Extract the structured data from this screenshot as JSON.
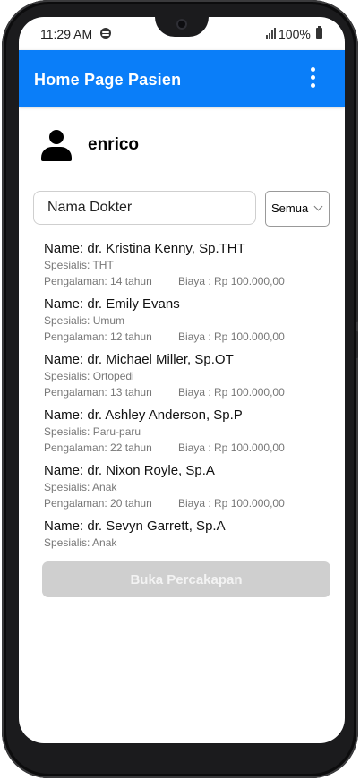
{
  "status_bar": {
    "time": "11:29 AM",
    "battery": "100%",
    "icons": [
      "spotify-icon",
      "signal-icon",
      "battery-icon"
    ]
  },
  "app_bar": {
    "title": "Home Page Pasien",
    "menu_icon": "more-vert-icon",
    "color": "#0a7ef9"
  },
  "user": {
    "name": "enrico",
    "icon": "person-icon"
  },
  "search": {
    "placeholder": "Nama Dokter",
    "value": ""
  },
  "filter": {
    "selected": "Semua"
  },
  "doctors": [
    {
      "name": "Name: dr. Kristina Kenny, Sp.THT",
      "spesialis": "Spesialis: THT",
      "pengalaman": "Pengalaman: 14 tahun",
      "biaya": "Biaya : Rp 100.000,00"
    },
    {
      "name": "Name: dr. Emily Evans",
      "spesialis": "Spesialis: Umum",
      "pengalaman": "Pengalaman: 12 tahun",
      "biaya": "Biaya : Rp 100.000,00"
    },
    {
      "name": "Name: dr. Michael Miller, Sp.OT",
      "spesialis": "Spesialis: Ortopedi",
      "pengalaman": "Pengalaman: 13 tahun",
      "biaya": "Biaya : Rp 100.000,00"
    },
    {
      "name": "Name: dr. Ashley Anderson, Sp.P",
      "spesialis": "Spesialis: Paru-paru",
      "pengalaman": "Pengalaman: 22 tahun",
      "biaya": "Biaya : Rp 100.000,00"
    },
    {
      "name": "Name: dr. Nixon Royle, Sp.A",
      "spesialis": "Spesialis: Anak",
      "pengalaman": "Pengalaman: 20 tahun",
      "biaya": "Biaya : Rp 100.000,00"
    },
    {
      "name": "Name: dr. Sevyn Garrett, Sp.A",
      "spesialis": "Spesialis: Anak",
      "pengalaman": "",
      "biaya": ""
    }
  ],
  "cta": {
    "label": "Buka Percakapan",
    "disabled": true,
    "color": "#cfcfcf"
  }
}
